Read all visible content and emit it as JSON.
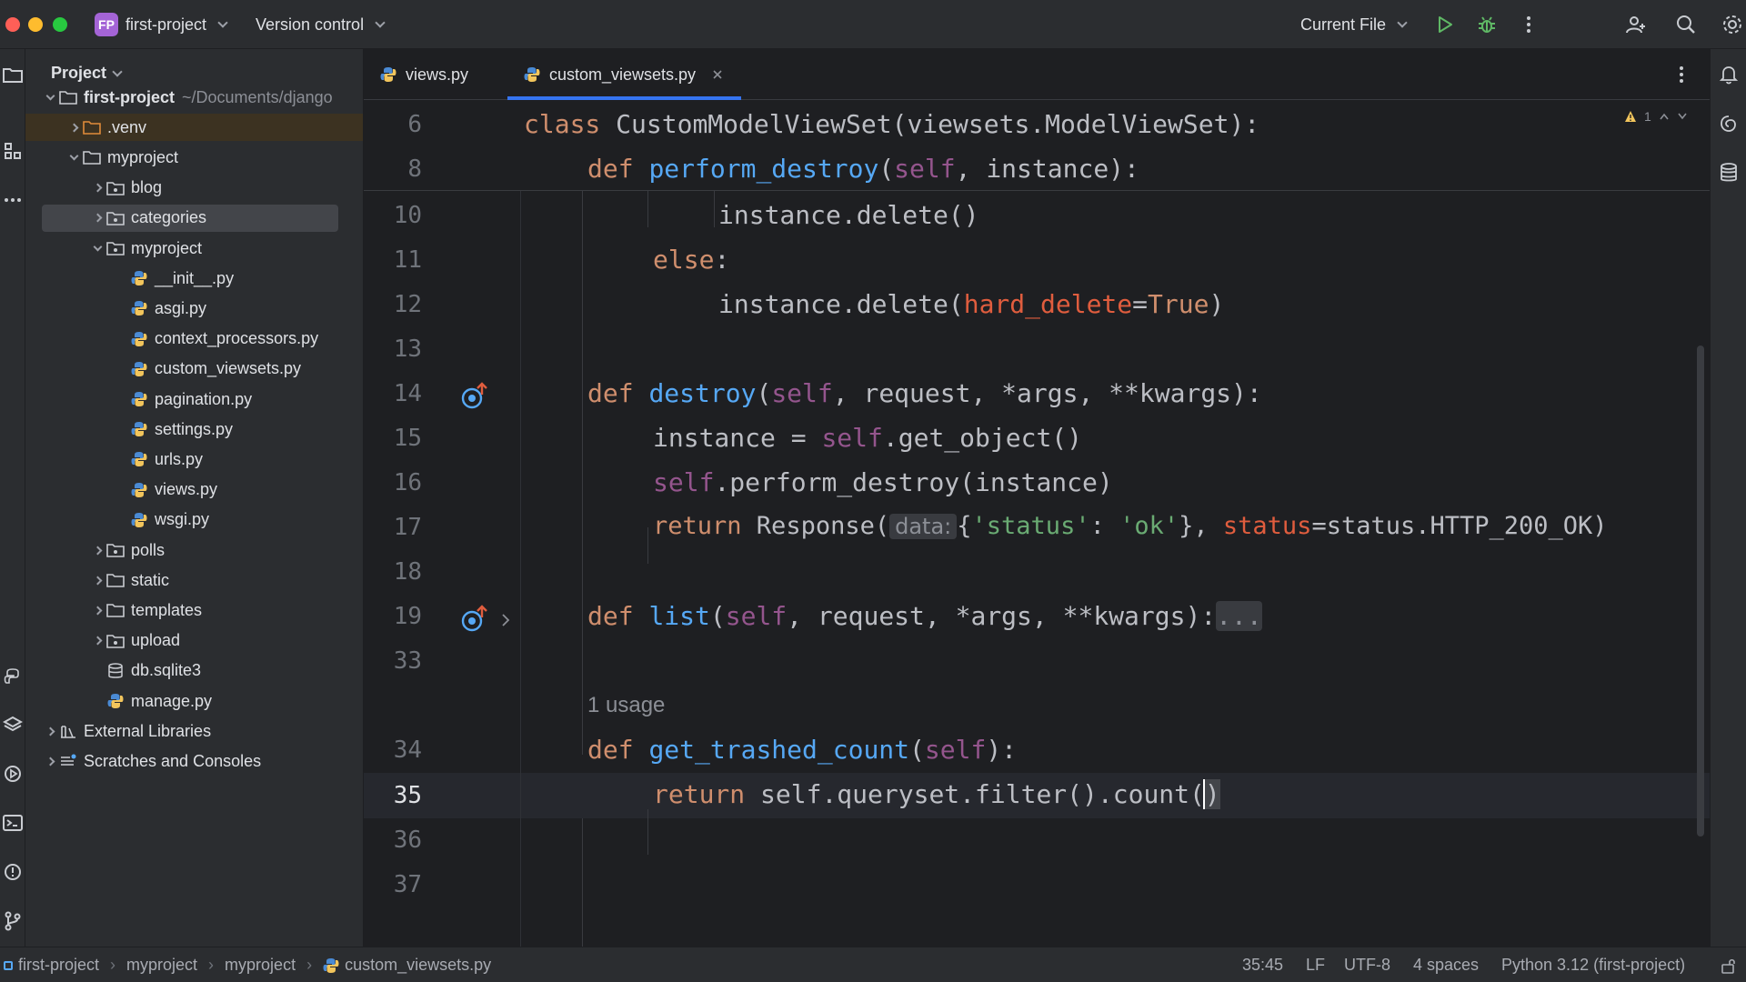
{
  "titlebar": {
    "project_badge": "FP",
    "project_name": "first-project",
    "vcs_label": "Version control",
    "run_config": "Current File",
    "icons": [
      "run-icon",
      "debug-icon",
      "more-icon",
      "add-user-icon",
      "search-icon",
      "settings-icon"
    ]
  },
  "project_panel": {
    "title": "Project",
    "tree": [
      {
        "label": "first-project",
        "hint": "~/Documents/django",
        "type": "folder",
        "depth": 0,
        "expanded": true,
        "bold": true
      },
      {
        "label": ".venv",
        "type": "folder-orange",
        "depth": 1,
        "expanded": false
      },
      {
        "label": "myproject",
        "type": "folder",
        "depth": 1,
        "expanded": true
      },
      {
        "label": "blog",
        "type": "package",
        "depth": 2,
        "expanded": false
      },
      {
        "label": "categories",
        "type": "package",
        "depth": 2,
        "expanded": false,
        "selected": true
      },
      {
        "label": "myproject",
        "type": "package",
        "depth": 2,
        "expanded": true
      },
      {
        "label": "__init__.py",
        "type": "python",
        "depth": 3
      },
      {
        "label": "asgi.py",
        "type": "python",
        "depth": 3
      },
      {
        "label": "context_processors.py",
        "type": "python",
        "depth": 3
      },
      {
        "label": "custom_viewsets.py",
        "type": "python",
        "depth": 3
      },
      {
        "label": "pagination.py",
        "type": "python",
        "depth": 3
      },
      {
        "label": "settings.py",
        "type": "python",
        "depth": 3
      },
      {
        "label": "urls.py",
        "type": "python",
        "depth": 3
      },
      {
        "label": "views.py",
        "type": "python",
        "depth": 3
      },
      {
        "label": "wsgi.py",
        "type": "python",
        "depth": 3
      },
      {
        "label": "polls",
        "type": "package",
        "depth": 2,
        "expanded": false
      },
      {
        "label": "static",
        "type": "folder",
        "depth": 2,
        "expanded": false
      },
      {
        "label": "templates",
        "type": "folder",
        "depth": 2,
        "expanded": false
      },
      {
        "label": "upload",
        "type": "package",
        "depth": 2,
        "expanded": false
      },
      {
        "label": "db.sqlite3",
        "type": "db",
        "depth": 2
      },
      {
        "label": "manage.py",
        "type": "python",
        "depth": 2
      },
      {
        "label": "External Libraries",
        "type": "library",
        "depth": 0,
        "expanded": false
      },
      {
        "label": "Scratches and Consoles",
        "type": "scratch",
        "depth": 0,
        "expanded": false
      }
    ]
  },
  "tabs": [
    {
      "label": "views.py",
      "active": false
    },
    {
      "label": "custom_viewsets.py",
      "active": true,
      "closable": true
    }
  ],
  "editor": {
    "warnings_count": "1",
    "usage_hint": "1 usage",
    "fold_placeholder": "...",
    "sticky_lines": [
      {
        "num": "6"
      },
      {
        "num": "8"
      }
    ],
    "lines": [
      {
        "num": "10"
      },
      {
        "num": "11"
      },
      {
        "num": "12"
      },
      {
        "num": "13"
      },
      {
        "num": "14"
      },
      {
        "num": "15"
      },
      {
        "num": "16"
      },
      {
        "num": "17"
      },
      {
        "num": "18"
      },
      {
        "num": "19"
      },
      {
        "num": "33"
      },
      {
        "num": "34"
      },
      {
        "num": "35"
      },
      {
        "num": "36"
      },
      {
        "num": "37"
      }
    ],
    "code": {
      "l6_kw": "class",
      "l6_rest": " CustomModelViewSet(viewsets.ModelViewSet):",
      "l8_kw": "def",
      "l8_fn": "perform_destroy",
      "l8_open": "(",
      "l8_self": "self",
      "l8_rest": ", instance):",
      "l10": "instance.delete()",
      "l11_kw": "else",
      "l11_rest": ":",
      "l12_a": "instance.delete(",
      "l12_named": "hard_delete",
      "l12_eq": "=",
      "l12_kw": "True",
      "l12_close": ")",
      "l14_kw": "def",
      "l14_fn": "destroy",
      "l14_open": "(",
      "l14_self": "self",
      "l14_rest": ", request, *args, **kwargs):",
      "l15_a": "instance = ",
      "l15_self": "self",
      "l15_rest": ".get_object()",
      "l16_self": "self",
      "l16_rest": ".perform_destroy(instance)",
      "l17_kw": "return",
      "l17_a": " Response(",
      "l17_hint": "data:",
      "l17_b": "{",
      "l17_s1": "'status'",
      "l17_c": ": ",
      "l17_s2": "'ok'",
      "l17_d": "}, ",
      "l17_named": "status",
      "l17_e": "=status.HTTP_200_OK)",
      "l19_kw": "def",
      "l19_fn": "list",
      "l19_open": "(",
      "l19_self": "self",
      "l19_rest": ", request, *args, **kwargs):",
      "l34_kw": "def",
      "l34_fn": "get_trashed_count",
      "l34_open": "(",
      "l34_self": "self",
      "l34_rest": "):",
      "l35_kw": "return",
      "l35_rest": " self.queryset.filter().count(",
      "l35_cursor": ")"
    }
  },
  "statusbar": {
    "breadcrumbs": [
      "first-project",
      "myproject",
      "myproject",
      "custom_viewsets.py"
    ],
    "caret": "35:45",
    "line_sep": "LF",
    "encoding": "UTF-8",
    "indent": "4 spaces",
    "interpreter": "Python 3.12 (first-project)"
  },
  "colors": {
    "accent": "#3574f0",
    "keyword": "#cf8e6d",
    "function": "#56a8f5",
    "string": "#6aab73",
    "self": "#94558d"
  }
}
